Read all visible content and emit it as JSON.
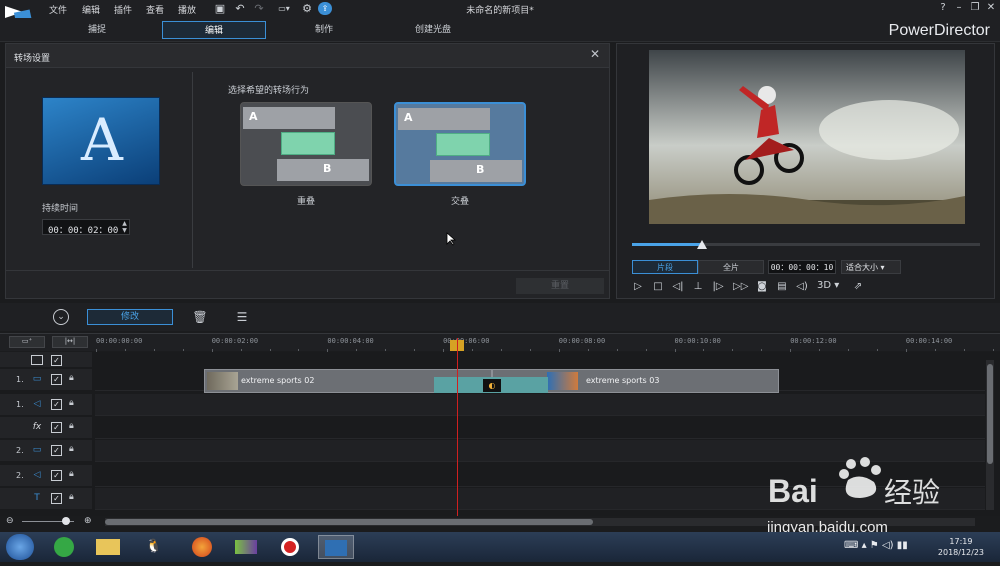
{
  "menu": [
    "文件",
    "编辑",
    "插件",
    "查看",
    "播放"
  ],
  "document_title": "未命名的新项目*",
  "mode_tabs": [
    "捕捉",
    "编辑",
    "制作",
    "创建光盘"
  ],
  "active_mode": "编辑",
  "brand": "PowerDirector",
  "transition_panel": {
    "title": "转场设置",
    "duration_label": "持续时间",
    "duration_value": "00：00：02：00",
    "behavior_label": "选择希望的转场行为",
    "options": [
      {
        "label": "重叠",
        "selected": false
      },
      {
        "label": "交叠",
        "selected": true
      }
    ],
    "reset_label": "重置"
  },
  "preview": {
    "clip_label": "片段",
    "movie_label": "全片",
    "timecode": "00：00：00：10",
    "fit_label": "适合大小",
    "three_d": "3D",
    "progress": 0.2
  },
  "toolbar": {
    "modify_label": "修改"
  },
  "timeline": {
    "ruler": [
      "00:00:00:00",
      "00:00:02:00",
      "00:00:04:00",
      "00:00:06:00",
      "00:00:08:00",
      "00:00:10:00",
      "00:00:12:00",
      "00:00:14:00"
    ],
    "tracks": [
      {
        "num": "1.",
        "icon": "video-track-icon",
        "glyph": "▭"
      },
      {
        "num": "1.",
        "icon": "audio-track-icon",
        "glyph": "◁"
      },
      {
        "num": "",
        "icon": "fx-track-icon",
        "glyph": "fx"
      },
      {
        "num": "2.",
        "icon": "video-track-icon",
        "glyph": "▭"
      },
      {
        "num": "2.",
        "icon": "audio-track-icon",
        "glyph": "◁"
      },
      {
        "num": "",
        "icon": "title-track-icon",
        "glyph": "T"
      }
    ],
    "clips": [
      {
        "name": "extreme sports 02"
      },
      {
        "name": "extreme sports 03"
      }
    ]
  },
  "taskbar": {
    "time": "17:19",
    "date": "2018/12/23"
  },
  "watermark": {
    "text": "jingyan.baidu.com",
    "logo": "Bai经验"
  }
}
